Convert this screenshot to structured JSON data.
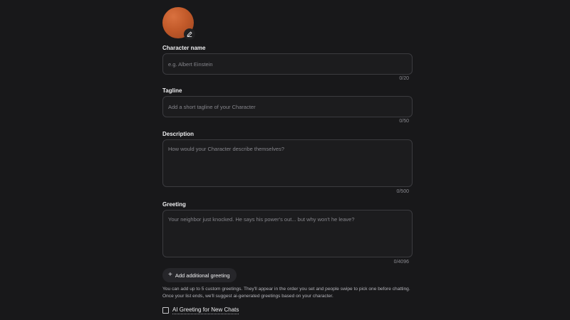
{
  "avatar": {
    "color": "#c25a2a",
    "edit_icon": "pencil-icon"
  },
  "fields": {
    "name": {
      "label": "Character name",
      "placeholder": "e.g. Albert Einstein",
      "counter": "0/20"
    },
    "tagline": {
      "label": "Tagline",
      "placeholder": "Add a short tagline of your Character",
      "counter": "0/50"
    },
    "description": {
      "label": "Description",
      "placeholder": "How would your Character describe themselves?",
      "counter": "0/500"
    },
    "greeting": {
      "label": "Greeting",
      "placeholder": "Your neighbor just knocked. He says his power's out... but why won't he leave?",
      "counter": "0/4096"
    }
  },
  "add_greeting": {
    "icon": "plus-icon",
    "label": "Add additional greeting"
  },
  "helper_text": "You can add up to 5 custom greetings. They'll appear in the order you set and people swipe to pick one before chatting. Once your list ends, we'll suggest ai-generated greetings based on your character.",
  "ai_greeting": {
    "label": "AI Greeting for New Chats",
    "checked": false
  }
}
